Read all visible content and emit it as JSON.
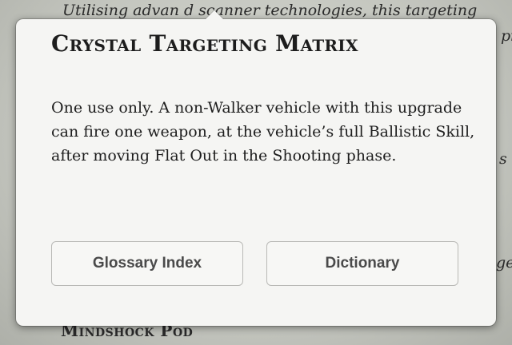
{
  "background_page": {
    "top_line": "Utilising advan   d scanner technologies, this targeting",
    "right_fragments": [
      "pi",
      "s p",
      "ge"
    ],
    "bottom_heading": "Mindshock Pod"
  },
  "popover": {
    "title": "Crystal Targeting Matrix",
    "body": "One use only. A non-Walker vehicle with this upgrade can fire one weapon, at the vehicle’s full Ballistic Skill, after moving Flat Out in the Shooting phase.",
    "buttons": {
      "glossary_label": "Glossary Index",
      "dictionary_label": "Dictionary"
    }
  }
}
